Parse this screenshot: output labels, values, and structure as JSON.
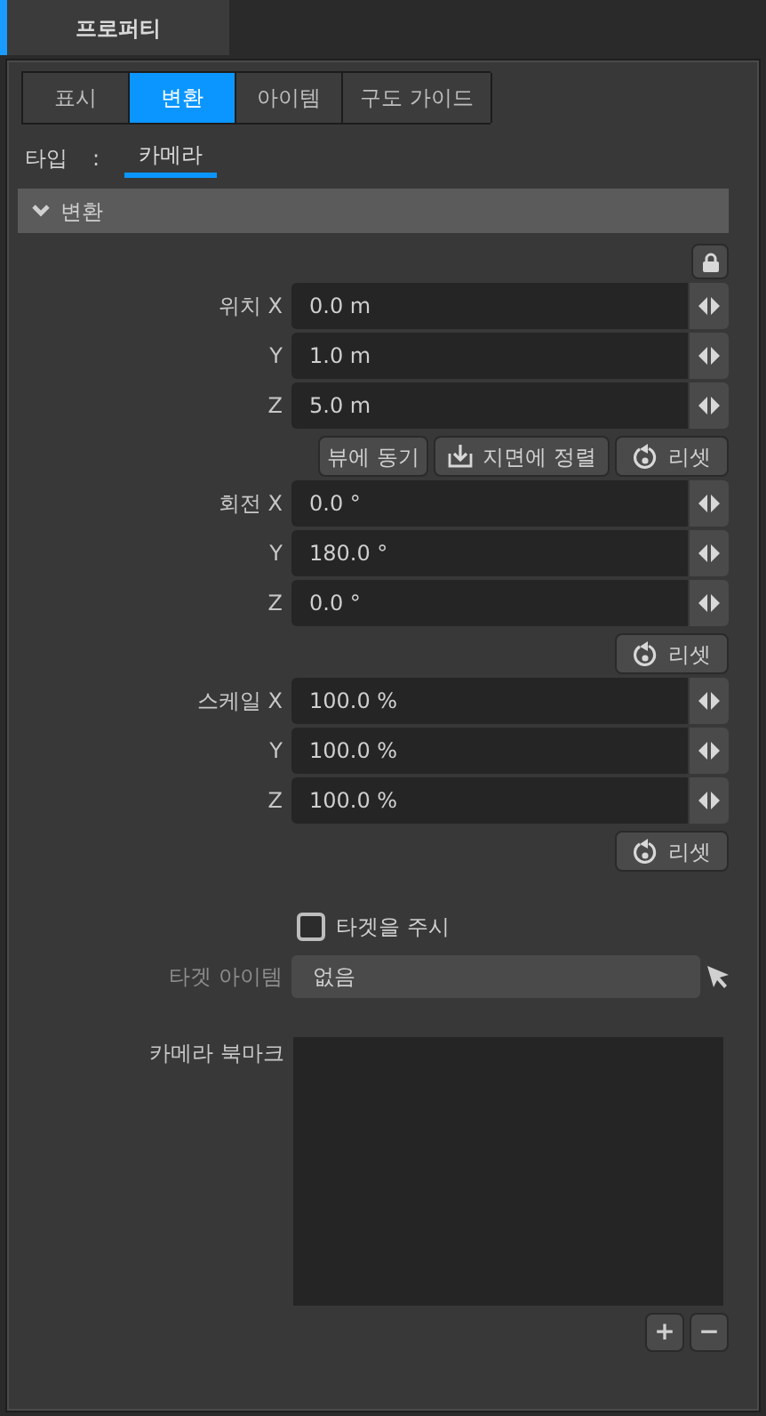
{
  "panel_tab": {
    "label": "프로퍼티",
    "selected": true
  },
  "tabs": [
    {
      "label": "표시",
      "selected": false
    },
    {
      "label": "변환",
      "selected": true
    },
    {
      "label": "아이템",
      "selected": false
    },
    {
      "label": "구도 가이드",
      "selected": false
    }
  ],
  "type": {
    "label": "타입",
    "separator": ":",
    "value": "카메라"
  },
  "section": {
    "title": "변환",
    "expanded": true
  },
  "groups": [
    {
      "rows": [
        {
          "label": "위치 X",
          "value": "0.0 m"
        },
        {
          "label": "Y",
          "value": "1.0 m"
        },
        {
          "label": "Z",
          "value": "5.0 m"
        }
      ],
      "buttons": [
        {
          "kind": "text",
          "label": "뷰에 동기"
        },
        {
          "kind": "align",
          "label": "지면에 정렬"
        },
        {
          "kind": "reset",
          "label": "리셋"
        }
      ]
    },
    {
      "rows": [
        {
          "label": "회전 X",
          "value": "0.0 °"
        },
        {
          "label": "Y",
          "value": "180.0 °"
        },
        {
          "label": "Z",
          "value": "0.0 °"
        }
      ],
      "buttons": [
        {
          "kind": "reset",
          "label": "리셋"
        }
      ]
    },
    {
      "rows": [
        {
          "label": "스케일 X",
          "value": "100.0 %"
        },
        {
          "label": "Y",
          "value": "100.0 %"
        },
        {
          "label": "Z",
          "value": "100.0 %"
        }
      ],
      "buttons": [
        {
          "kind": "reset",
          "label": "리셋"
        }
      ]
    }
  ],
  "look_at_target": {
    "label": "타겟을 주시",
    "checked": false
  },
  "target_item": {
    "label": "타겟 아이템",
    "value": "없음",
    "disabled": true
  },
  "bookmarks": {
    "label": "카메라 북마크",
    "buttons": [
      "+",
      "−"
    ]
  }
}
